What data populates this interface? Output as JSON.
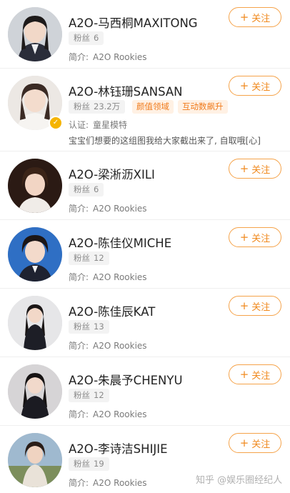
{
  "accounts": [
    {
      "name": "A2O-马西桐MAXITONG",
      "fans_label": "粉丝",
      "fans": "6",
      "intro_label": "简介:",
      "intro": "A2O Rookies",
      "follow": "关注"
    },
    {
      "name": "A2O-林钰珊SANSAN",
      "fans_label": "粉丝",
      "fans": "23.2万",
      "tags": [
        "颜值领域",
        "互动数飙升"
      ],
      "cert_label": "认证:",
      "cert": "童星模特",
      "desc": "宝宝们想要的这组图我给大家截出来了, 自取哦[心]",
      "follow": "关注",
      "verified": true
    },
    {
      "name": "A2O-梁淅沥XILI",
      "fans_label": "粉丝",
      "fans": "6",
      "intro_label": "简介:",
      "intro": "A2O Rookies",
      "follow": "关注"
    },
    {
      "name": "A2O-陈佳仪MICHE",
      "fans_label": "粉丝",
      "fans": "12",
      "intro_label": "简介:",
      "intro": "A2O Rookies",
      "follow": "关注"
    },
    {
      "name": "A2O-陈佳辰KAT",
      "fans_label": "粉丝",
      "fans": "13",
      "intro_label": "简介:",
      "intro": "A2O Rookies",
      "follow": "关注"
    },
    {
      "name": "A2O-朱晨予CHENYU",
      "fans_label": "粉丝",
      "fans": "12",
      "intro_label": "简介:",
      "intro": "A2O Rookies",
      "follow": "关注"
    },
    {
      "name": "A2O-李诗洁SHIJIE",
      "fans_label": "粉丝",
      "fans": "19",
      "intro_label": "简介:",
      "intro": "A2O Rookies",
      "follow": "关注"
    }
  ],
  "watermark": "知乎 @娱乐圈经纪人",
  "colors": {
    "accent": "#f08a1f",
    "tag_bg": "#fff1e4",
    "fans_bg": "#f3f3f3"
  }
}
